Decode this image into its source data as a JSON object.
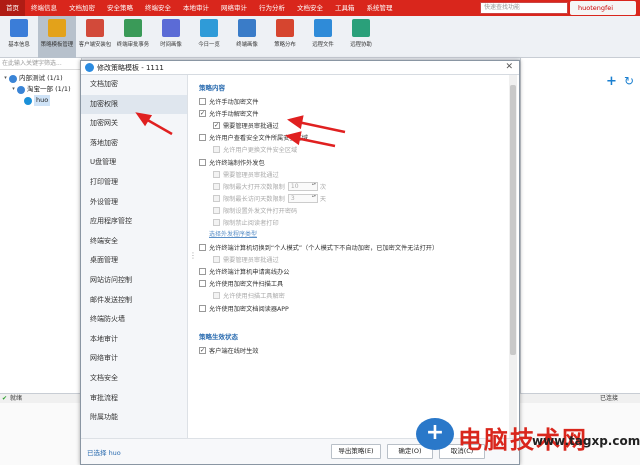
{
  "top_menu": [
    "首页",
    "终端信息",
    "文档加密",
    "安全策略",
    "终端安全",
    "本地审计",
    "网络审计",
    "行为分析",
    "文档安全",
    "工具箱",
    "系统管理"
  ],
  "top_menu_active_index": 0,
  "search_placeholder": "快速查找功能",
  "user": "huotengfei",
  "toolbar": [
    "基本信息",
    "策略模板管理",
    "客户端安装包",
    "终端审批事务",
    "时间画像",
    "今日一览",
    "终端画像",
    "策略分布",
    "远程文件",
    "远程协助"
  ],
  "toolbar_active_index": 1,
  "filter_placeholder": "在此输入关键字筛选...",
  "tree": [
    {
      "label": "内部测试 (1/1)"
    },
    {
      "label": "淘宝一部 (1/1)"
    },
    {
      "label": "huo"
    }
  ],
  "status": {
    "left": "就绪",
    "right": "已连接"
  },
  "dialog": {
    "title": "修改策略模板 - 1111",
    "nav": [
      "文档加密",
      "加密权限",
      "加密网关",
      "落地加密",
      "U盘管理",
      "打印管理",
      "外设管理",
      "应用程序管控",
      "终端安全",
      "桌面管理",
      "网站访问控制",
      "邮件发送控制",
      "终端防火墙",
      "本地审计",
      "网络审计",
      "文档安全",
      "审批流程",
      "附属功能"
    ],
    "nav_active_index": 1,
    "section1": "策略内容",
    "options": [
      {
        "label": "允许手动加密文件",
        "checked": false,
        "dim": false,
        "indent": 0
      },
      {
        "label": "允许手动解密文件",
        "checked": true,
        "dim": false,
        "indent": 0
      },
      {
        "label": "需要管理员审批通过",
        "checked": true,
        "dim": false,
        "indent": 1
      },
      {
        "label": "允许用户查看安全文件所属安全区域",
        "checked": false,
        "dim": false,
        "indent": 0
      },
      {
        "label": "允许用户更换文件安全区域",
        "checked": false,
        "dim": true,
        "indent": 1
      },
      {
        "label": "允许终端制作外发包",
        "checked": false,
        "dim": false,
        "indent": 0
      },
      {
        "label": "需要管理员审批通过",
        "checked": false,
        "dim": true,
        "indent": 1
      },
      {
        "label": "限制最大打开次数限制",
        "checked": false,
        "dim": true,
        "indent": 1,
        "num": "10",
        "unit": "次"
      },
      {
        "label": "限制最长访问天数限制",
        "checked": false,
        "dim": true,
        "indent": 1,
        "num": "3",
        "unit": "天"
      },
      {
        "label": "限制设置外发文件打开密码",
        "checked": false,
        "dim": true,
        "indent": 1
      },
      {
        "label": "限制禁止阅读者打印",
        "checked": false,
        "dim": true,
        "indent": 1
      }
    ],
    "link": "选择外发程序类型",
    "options2": [
      {
        "label": "允许终端计算机切换到“个人模式”（个人模式下不自动加密，已加密文件无法打开）",
        "checked": false,
        "dim": false,
        "indent": 0
      },
      {
        "label": "需要管理员审批通过",
        "checked": false,
        "dim": true,
        "indent": 1
      },
      {
        "label": "允许终端计算机申请离线办公",
        "checked": false,
        "dim": false,
        "indent": 0
      },
      {
        "label": "允许使用加密文件扫描工具",
        "checked": false,
        "dim": false,
        "indent": 0
      },
      {
        "label": "允许使用扫描工具解密",
        "checked": false,
        "dim": true,
        "indent": 1
      },
      {
        "label": "允许使用加密文档阅读器APP",
        "checked": false,
        "dim": false,
        "indent": 0
      }
    ],
    "section2": "策略生效状态",
    "options3": [
      {
        "label": "客户端在线时生效",
        "checked": true,
        "dim": false,
        "indent": 0
      }
    ],
    "selected_label": "已选择 huo",
    "export_btn": "导出策略(E)",
    "ok_btn": "确定(O)",
    "cancel_btn": "取消(C)"
  },
  "watermark": {
    "brand": "电脑技术网",
    "site": "www.tagxp.com"
  },
  "colors": {
    "topbar": "#d9261c",
    "accent": "#2b6cb0",
    "arrow": "#e02020"
  }
}
